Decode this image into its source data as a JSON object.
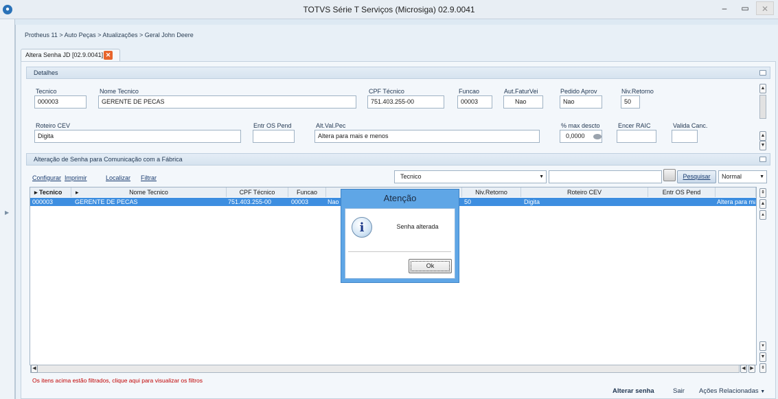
{
  "window": {
    "title": "TOTVS Série T Serviços (Microsiga) 02.9.0041",
    "minimize": "–",
    "maximize": "▭",
    "close": "✕"
  },
  "breadcrumb": "Protheus 11 > Auto Peças > Atualizações > Geral John Deere",
  "tab": {
    "label": "Altera Senha JD [02.9.0041]",
    "close": "✕"
  },
  "detalhes": {
    "title": "Detalhes",
    "fields": {
      "tecnico": {
        "label": "Tecnico",
        "value": "000003"
      },
      "nome_tecnico": {
        "label": "Nome Tecnico",
        "value": "GERENTE DE PECAS"
      },
      "cpf_tecnico": {
        "label": "CPF Técnico",
        "value": "751.403.255-00"
      },
      "funcao": {
        "label": "Funcao",
        "value": "00003"
      },
      "aut_faturvei": {
        "label": "Aut.FaturVei",
        "value": "Nao"
      },
      "pedido_aprov": {
        "label": "Pedido Aprov",
        "value": "Nao"
      },
      "niv_retorno": {
        "label": "Niv.Retorno",
        "value": "50"
      },
      "roteiro_cev": {
        "label": "Roteiro CEV",
        "value": "Digita"
      },
      "entr_os_pend": {
        "label": "Entr OS Pend",
        "value": ""
      },
      "alt_val_pec": {
        "label": "Alt.Val.Pec",
        "value": "Altera para mais e menos"
      },
      "max_descto": {
        "label": "% max descto",
        "value": "0,0000"
      },
      "encer_raic": {
        "label": "Encer RAIC",
        "value": ""
      },
      "valida_canc": {
        "label": "Valida Canc.",
        "value": ""
      }
    }
  },
  "grid_section": {
    "title": "Alteração de Senha para Comunicação com a Fábrica",
    "toolbar": {
      "configurar": "Configurar",
      "imprimir": "Imprimir",
      "localizar": "Localizar",
      "filtrar": "Filtrar",
      "search_field": "Tecnico",
      "search_value": "",
      "pesquisar": "Pesquisar",
      "view_mode": "Normal"
    },
    "columns": [
      "Tecnico",
      "Nome Tecnico",
      "CPF Técnico",
      "Funcao",
      "Niv.Retorno",
      "Roteiro CEV",
      "Entr OS Pend"
    ],
    "rows": [
      {
        "tecnico": "000003",
        "nome": "GERENTE DE PECAS",
        "cpf": "751.403.255-00",
        "funcao": "00003",
        "aut": "Nao",
        "niv": "50",
        "roteiro": "Digita",
        "entr": "",
        "altval": "Altera para mais"
      }
    ],
    "filter_message": "Os itens acima estão filtrados, clique aqui para visualizar os filtros"
  },
  "footer": {
    "alterar_senha": "Alterar senha",
    "sair": "Sair",
    "acoes": "Ações Relacionadas"
  },
  "dialog": {
    "title": "Atenção",
    "message": "Senha alterada",
    "ok": "Ok"
  },
  "colors": {
    "selection": "#3d8ee0",
    "accent": "#2a72b8",
    "filter_text": "#c00000",
    "dialog_frame": "#5fa6e6"
  }
}
